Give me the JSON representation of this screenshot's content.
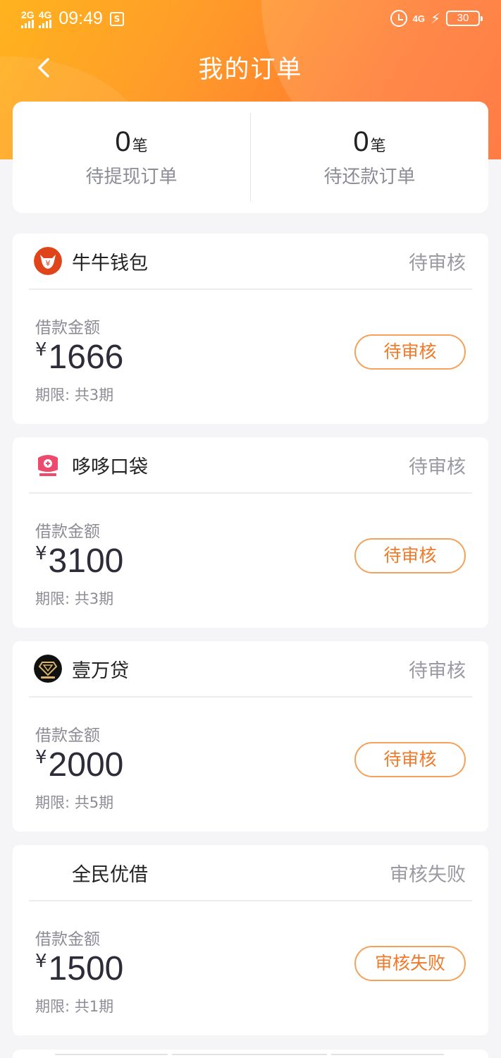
{
  "status_bar": {
    "sim1": "2G",
    "sim2": "4G",
    "time": "09:49",
    "s_icon": "S",
    "net": "4G",
    "battery": "30"
  },
  "nav": {
    "title": "我的订单",
    "back_icon": "chevron-left-icon"
  },
  "summary": {
    "withdraw": {
      "count": "0",
      "unit": "笔",
      "label": "待提现订单"
    },
    "repay": {
      "count": "0",
      "unit": "笔",
      "label": "待还款订单"
    }
  },
  "orders": [
    {
      "app_name": "牛牛钱包",
      "head_status": "待审核",
      "amount_label": "借款金额",
      "currency": "¥",
      "amount": "1666",
      "period": "期限: 共3期",
      "status_button": "待审核",
      "logo_color": "#e0441a"
    },
    {
      "app_name": "哆哆口袋",
      "head_status": "待审核",
      "amount_label": "借款金额",
      "currency": "¥",
      "amount": "3100",
      "period": "期限: 共3期",
      "status_button": "待审核",
      "logo_color": "#ec4b6e"
    },
    {
      "app_name": "壹万贷",
      "head_status": "待审核",
      "amount_label": "借款金额",
      "currency": "¥",
      "amount": "2000",
      "period": "期限: 共5期",
      "status_button": "待审核",
      "logo_color": "#111111"
    },
    {
      "app_name": "全民优借",
      "head_status": "审核失败",
      "amount_label": "借款金额",
      "currency": "¥",
      "amount": "1500",
      "period": "期限: 共1期",
      "status_button": "审核失败"
    }
  ],
  "colors": {
    "header_gradient_start": "#ffb31e",
    "header_gradient_end": "#ff6a2c",
    "status_button_border": "#f5a15a",
    "status_button_text": "#f07a2a"
  }
}
